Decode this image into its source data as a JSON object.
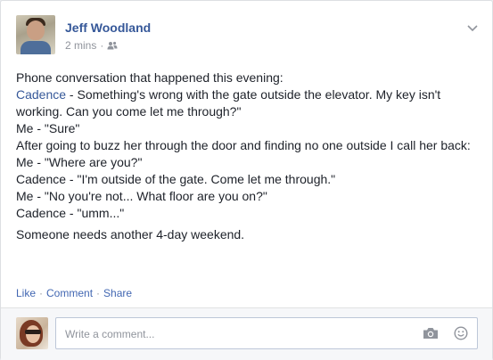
{
  "post": {
    "author": "Jeff Woodland",
    "timestamp": "2 mins",
    "separator": "·",
    "audience_icon": "friends-icon",
    "menu_icon": "chevron-down-icon",
    "lines": [
      {
        "text": "Phone conversation that happened this evening:"
      },
      {
        "mention": "Cadence",
        "text": " - Something's wrong with the gate outside the elevator. My key isn't working. Can you come let me through?\""
      },
      {
        "text": "Me - \"Sure\""
      },
      {
        "text": "After going to buzz her through the door and finding no one outside I call her back:"
      },
      {
        "text": "Me - \"Where are you?\""
      },
      {
        "text": "Cadence - \"I'm outside of the gate. Come let me through.\""
      },
      {
        "text": "Me - \"No you're not... What floor are you on?\""
      },
      {
        "text": "Cadence - \"umm...\""
      }
    ],
    "closing": "Someone needs another 4-day weekend."
  },
  "actions": {
    "like": "Like",
    "comment": "Comment",
    "share": "Share",
    "separator": "·"
  },
  "comment_box": {
    "placeholder": "Write a comment...",
    "camera_icon": "camera-icon",
    "emoji_icon": "smiley-icon"
  },
  "colors": {
    "link": "#365899",
    "text": "#1d2129",
    "meta": "#90949c"
  }
}
